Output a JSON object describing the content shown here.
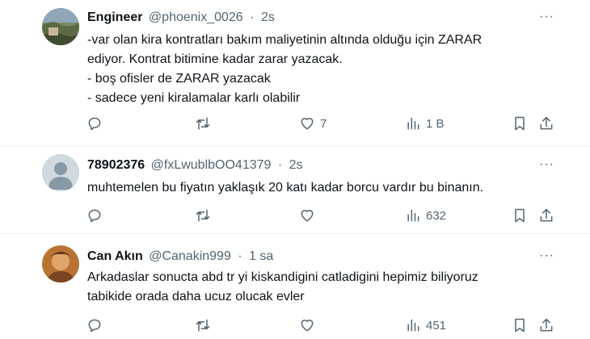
{
  "tweets": [
    {
      "name": "Engineer",
      "handle": "@phoenix_0026",
      "dot": "·",
      "time": "2s",
      "lines": [
        "-var olan kira kontratları bakım maliyetinin altında olduğu için ZARAR",
        "ediyor. Kontrat bitimine kadar zarar yazacak.",
        "- boş ofisler de ZARAR yazacak",
        "- sadece yeni kiralamalar karlı olabilir"
      ],
      "likes": "7",
      "views": "1 B"
    },
    {
      "name": "78902376",
      "handle": "@fxLwublbOO41379",
      "dot": "·",
      "time": "2s",
      "lines": [
        "muhtemelen bu fiyatın yaklaşık 20 katı kadar borcu vardır bu binanın."
      ],
      "likes": "",
      "views": "632"
    },
    {
      "name": "Can Akın",
      "handle": "@Canakin999",
      "dot": "·",
      "time": "1 sa",
      "lines": [
        "Arkadaslar sonucta abd tr yi kiskandigini catladigini hepimiz biliyoruz",
        "tabikide orada daha ucuz olucak evler"
      ],
      "likes": "",
      "views": "451"
    }
  ],
  "more_label": "···",
  "icons": {
    "reply": "reply-icon",
    "retweet": "retweet-icon",
    "like": "heart-icon",
    "views": "views-chart-icon",
    "bookmark": "bookmark-icon",
    "share": "share-icon"
  },
  "colors": {
    "text": "#0f1419",
    "muted": "#536471",
    "divider": "#eff3f4"
  }
}
